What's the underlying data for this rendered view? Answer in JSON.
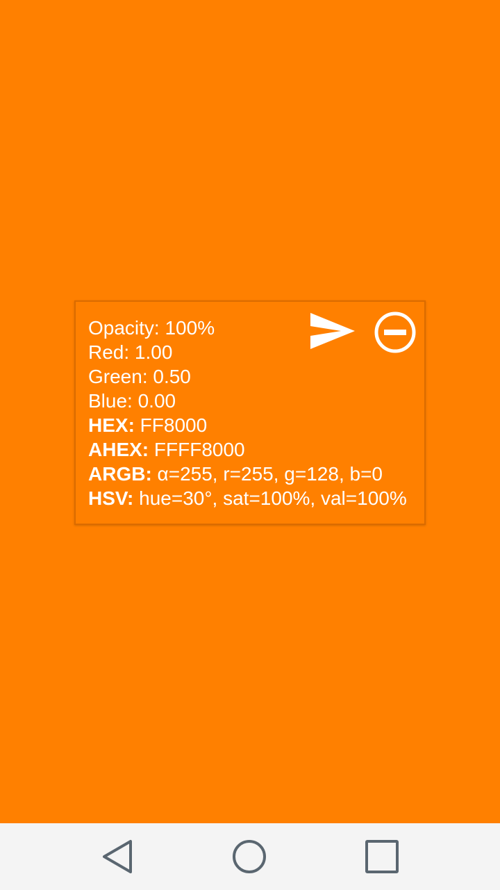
{
  "background_color": "#ff8000",
  "info": {
    "opacity": "Opacity: 100%",
    "red": "Red: 1.00",
    "green": "Green: 0.50",
    "blue": "Blue: 0.00",
    "hex_label": "HEX:",
    "hex_value": " FF8000",
    "ahex_label": "AHEX:",
    "ahex_value": " FFFF8000",
    "argb_label": "ARGB:",
    "argb_value": " α=255, r=255, g=128, b=0",
    "hsv_label": "HSV:",
    "hsv_value": " hue=30°, sat=100%, val=100%"
  },
  "actions": {
    "share_icon": "send-icon",
    "remove_icon": "remove-circle-icon"
  },
  "nav": {
    "back_icon": "back-triangle-icon",
    "home_icon": "home-circle-icon",
    "recents_icon": "recents-square-icon"
  }
}
